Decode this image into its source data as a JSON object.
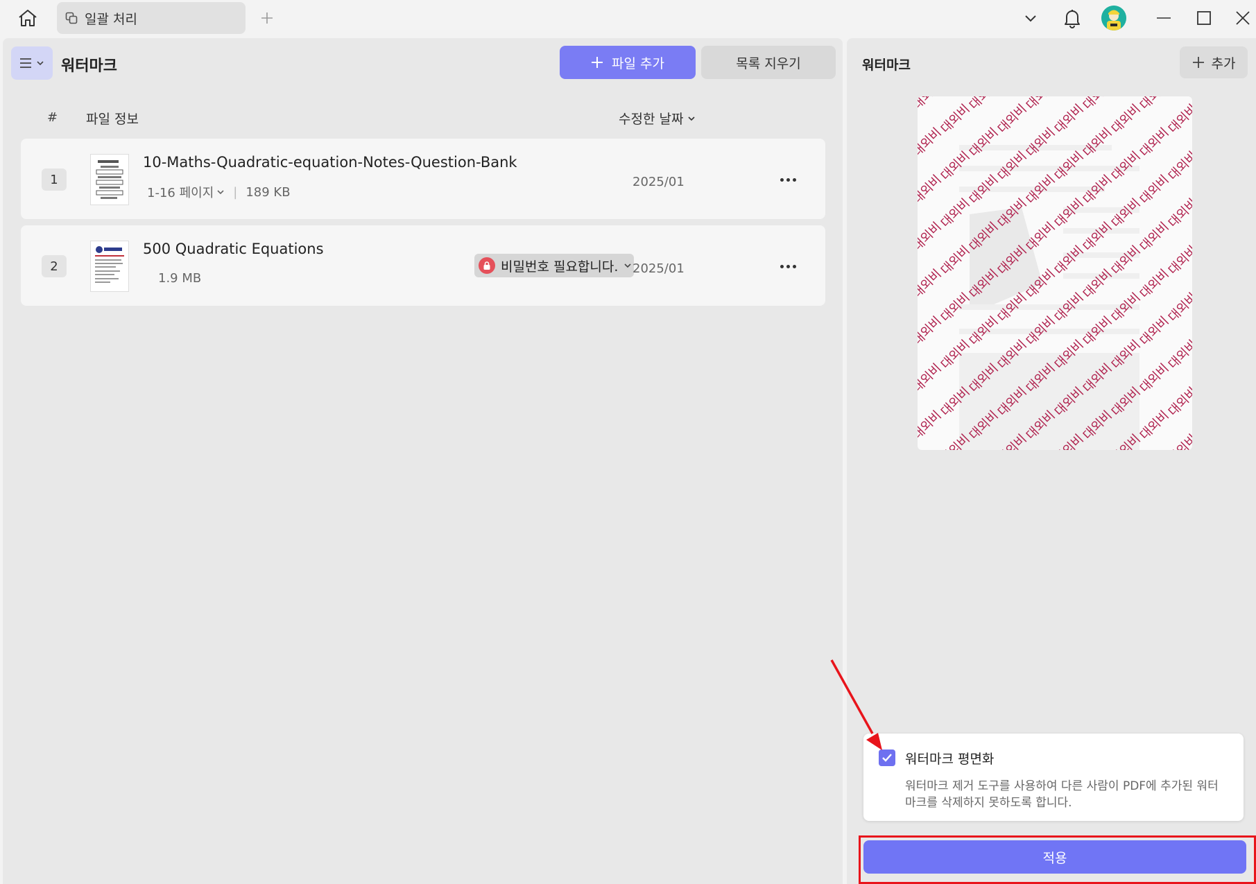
{
  "window": {
    "tab_label": "일괄 처리"
  },
  "left": {
    "title": "워터마크",
    "add_file_label": "파일 추가",
    "clear_list_label": "목록 지우기",
    "columns": {
      "hash": "#",
      "file_info": "파일 정보",
      "modified_date": "수정한 날짜"
    },
    "files": [
      {
        "num": "1",
        "name": "10-Maths-Quadratic-equation-Notes-Question-Bank",
        "pages": "1-16 페이지",
        "size": "189 KB",
        "date": "2025/01"
      },
      {
        "num": "2",
        "name": "500 Quadratic Equations",
        "size": "1.9 MB",
        "badge": "비밀번호 필요합니다.",
        "date": "2025/01"
      }
    ]
  },
  "right": {
    "title": "워터마크",
    "add_label": "추가",
    "watermark_text": "대외비",
    "flatten": {
      "checked": true,
      "label": "워터마크 평면화",
      "description": "워터마크 제거 도구를 사용하여 다른 사람이 PDF에 추가된 워터마크를 삭제하지 못하도록 합니다."
    },
    "apply_label": "적용"
  },
  "colors": {
    "accent": "#7a7cf4",
    "watermark": "#b0224e",
    "highlight": "#e8141b",
    "lock_badge": "#e5505a"
  }
}
